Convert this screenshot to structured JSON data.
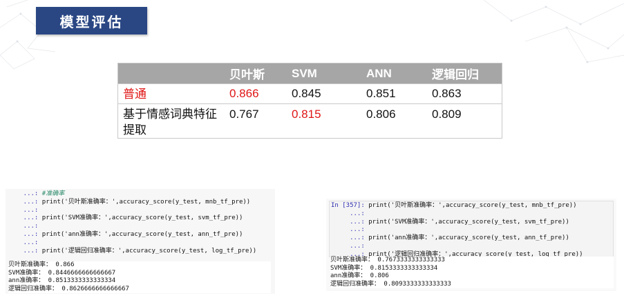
{
  "title": "模型评估",
  "table": {
    "headers": [
      "",
      "贝叶斯",
      "SVM",
      "ANN",
      "逻辑回归"
    ],
    "rows": [
      {
        "label": "普通",
        "values": [
          "0.866",
          "0.845",
          "0.851",
          "0.863"
        ]
      },
      {
        "label": "基于情感词典特征提取",
        "values": [
          "0.767",
          "0.815",
          "0.806",
          "0.809"
        ]
      }
    ]
  },
  "left_code": {
    "lines": [
      {
        "prompt": "    ...: ",
        "text": "#准确率"
      },
      {
        "prompt": "    ...: ",
        "text": "print('贝叶斯准确率：',accuracy_score(y_test, mnb_tf_pre))"
      },
      {
        "prompt": "    ...: ",
        "text": ""
      },
      {
        "prompt": "    ...: ",
        "text": "print('SVM准确率：',accuracy_score(y_test, svm_tf_pre))"
      },
      {
        "prompt": "    ...: ",
        "text": ""
      },
      {
        "prompt": "    ...: ",
        "text": "print('ann准确率：',accuracy_score(y_test, ann_tf_pre))"
      },
      {
        "prompt": "    ...: ",
        "text": ""
      },
      {
        "prompt": "    ...: ",
        "text": "print('逻辑回归准确率：',accuracy_score(y_test, log_tf_pre))"
      }
    ],
    "output": [
      "贝叶斯准确率： 0.866",
      "SVM准确率： 0.8446666666666667",
      "ann准确率： 0.8513333333333334",
      "逻辑回归准确率： 0.8626666666666667"
    ]
  },
  "right_code": {
    "lines": [
      {
        "prompt": "In [357]: ",
        "text": "print('贝叶斯准确率：',accuracy_score(y_test, mnb_tf_pre))"
      },
      {
        "prompt": "     ...: ",
        "text": ""
      },
      {
        "prompt": "     ...: ",
        "text": "print('SVM准确率：',accuracy_score(y_test, svm_tf_pre))"
      },
      {
        "prompt": "     ...: ",
        "text": ""
      },
      {
        "prompt": "     ...: ",
        "text": "print('ann准确率：',accuracy_score(y_test, ann_tf_pre))"
      },
      {
        "prompt": "     ...: ",
        "text": ""
      },
      {
        "prompt": "     ...: ",
        "text": "print('逻辑回归准确率：',accuracy_score(y_test, log_tf_pre))"
      }
    ],
    "output": [
      "贝叶斯准确率： 0.7673333333333333",
      "SVM准确率： 0.8153333333333334",
      "ann准确率： 0.806",
      "逻辑回归准确率： 0.8093333333333333"
    ]
  },
  "colors": {
    "title_bg": "#2a4784",
    "header_bg": "#a6a6a6",
    "highlight": "#e01515"
  }
}
